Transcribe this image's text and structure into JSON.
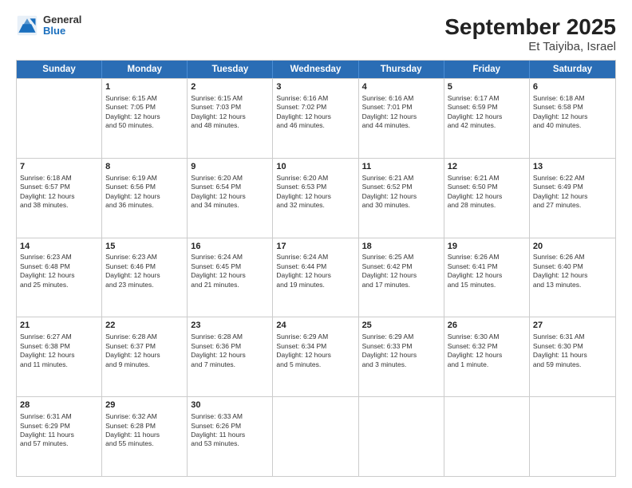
{
  "logo": {
    "general": "General",
    "blue": "Blue"
  },
  "title": "September 2025",
  "subtitle": "Et Taiyiba, Israel",
  "header_days": [
    "Sunday",
    "Monday",
    "Tuesday",
    "Wednesday",
    "Thursday",
    "Friday",
    "Saturday"
  ],
  "weeks": [
    [
      {
        "day": "",
        "content": ""
      },
      {
        "day": "1",
        "content": "Sunrise: 6:15 AM\nSunset: 7:05 PM\nDaylight: 12 hours\nand 50 minutes."
      },
      {
        "day": "2",
        "content": "Sunrise: 6:15 AM\nSunset: 7:03 PM\nDaylight: 12 hours\nand 48 minutes."
      },
      {
        "day": "3",
        "content": "Sunrise: 6:16 AM\nSunset: 7:02 PM\nDaylight: 12 hours\nand 46 minutes."
      },
      {
        "day": "4",
        "content": "Sunrise: 6:16 AM\nSunset: 7:01 PM\nDaylight: 12 hours\nand 44 minutes."
      },
      {
        "day": "5",
        "content": "Sunrise: 6:17 AM\nSunset: 6:59 PM\nDaylight: 12 hours\nand 42 minutes."
      },
      {
        "day": "6",
        "content": "Sunrise: 6:18 AM\nSunset: 6:58 PM\nDaylight: 12 hours\nand 40 minutes."
      }
    ],
    [
      {
        "day": "7",
        "content": "Sunrise: 6:18 AM\nSunset: 6:57 PM\nDaylight: 12 hours\nand 38 minutes."
      },
      {
        "day": "8",
        "content": "Sunrise: 6:19 AM\nSunset: 6:56 PM\nDaylight: 12 hours\nand 36 minutes."
      },
      {
        "day": "9",
        "content": "Sunrise: 6:20 AM\nSunset: 6:54 PM\nDaylight: 12 hours\nand 34 minutes."
      },
      {
        "day": "10",
        "content": "Sunrise: 6:20 AM\nSunset: 6:53 PM\nDaylight: 12 hours\nand 32 minutes."
      },
      {
        "day": "11",
        "content": "Sunrise: 6:21 AM\nSunset: 6:52 PM\nDaylight: 12 hours\nand 30 minutes."
      },
      {
        "day": "12",
        "content": "Sunrise: 6:21 AM\nSunset: 6:50 PM\nDaylight: 12 hours\nand 28 minutes."
      },
      {
        "day": "13",
        "content": "Sunrise: 6:22 AM\nSunset: 6:49 PM\nDaylight: 12 hours\nand 27 minutes."
      }
    ],
    [
      {
        "day": "14",
        "content": "Sunrise: 6:23 AM\nSunset: 6:48 PM\nDaylight: 12 hours\nand 25 minutes."
      },
      {
        "day": "15",
        "content": "Sunrise: 6:23 AM\nSunset: 6:46 PM\nDaylight: 12 hours\nand 23 minutes."
      },
      {
        "day": "16",
        "content": "Sunrise: 6:24 AM\nSunset: 6:45 PM\nDaylight: 12 hours\nand 21 minutes."
      },
      {
        "day": "17",
        "content": "Sunrise: 6:24 AM\nSunset: 6:44 PM\nDaylight: 12 hours\nand 19 minutes."
      },
      {
        "day": "18",
        "content": "Sunrise: 6:25 AM\nSunset: 6:42 PM\nDaylight: 12 hours\nand 17 minutes."
      },
      {
        "day": "19",
        "content": "Sunrise: 6:26 AM\nSunset: 6:41 PM\nDaylight: 12 hours\nand 15 minutes."
      },
      {
        "day": "20",
        "content": "Sunrise: 6:26 AM\nSunset: 6:40 PM\nDaylight: 12 hours\nand 13 minutes."
      }
    ],
    [
      {
        "day": "21",
        "content": "Sunrise: 6:27 AM\nSunset: 6:38 PM\nDaylight: 12 hours\nand 11 minutes."
      },
      {
        "day": "22",
        "content": "Sunrise: 6:28 AM\nSunset: 6:37 PM\nDaylight: 12 hours\nand 9 minutes."
      },
      {
        "day": "23",
        "content": "Sunrise: 6:28 AM\nSunset: 6:36 PM\nDaylight: 12 hours\nand 7 minutes."
      },
      {
        "day": "24",
        "content": "Sunrise: 6:29 AM\nSunset: 6:34 PM\nDaylight: 12 hours\nand 5 minutes."
      },
      {
        "day": "25",
        "content": "Sunrise: 6:29 AM\nSunset: 6:33 PM\nDaylight: 12 hours\nand 3 minutes."
      },
      {
        "day": "26",
        "content": "Sunrise: 6:30 AM\nSunset: 6:32 PM\nDaylight: 12 hours\nand 1 minute."
      },
      {
        "day": "27",
        "content": "Sunrise: 6:31 AM\nSunset: 6:30 PM\nDaylight: 11 hours\nand 59 minutes."
      }
    ],
    [
      {
        "day": "28",
        "content": "Sunrise: 6:31 AM\nSunset: 6:29 PM\nDaylight: 11 hours\nand 57 minutes."
      },
      {
        "day": "29",
        "content": "Sunrise: 6:32 AM\nSunset: 6:28 PM\nDaylight: 11 hours\nand 55 minutes."
      },
      {
        "day": "30",
        "content": "Sunrise: 6:33 AM\nSunset: 6:26 PM\nDaylight: 11 hours\nand 53 minutes."
      },
      {
        "day": "",
        "content": ""
      },
      {
        "day": "",
        "content": ""
      },
      {
        "day": "",
        "content": ""
      },
      {
        "day": "",
        "content": ""
      }
    ]
  ]
}
